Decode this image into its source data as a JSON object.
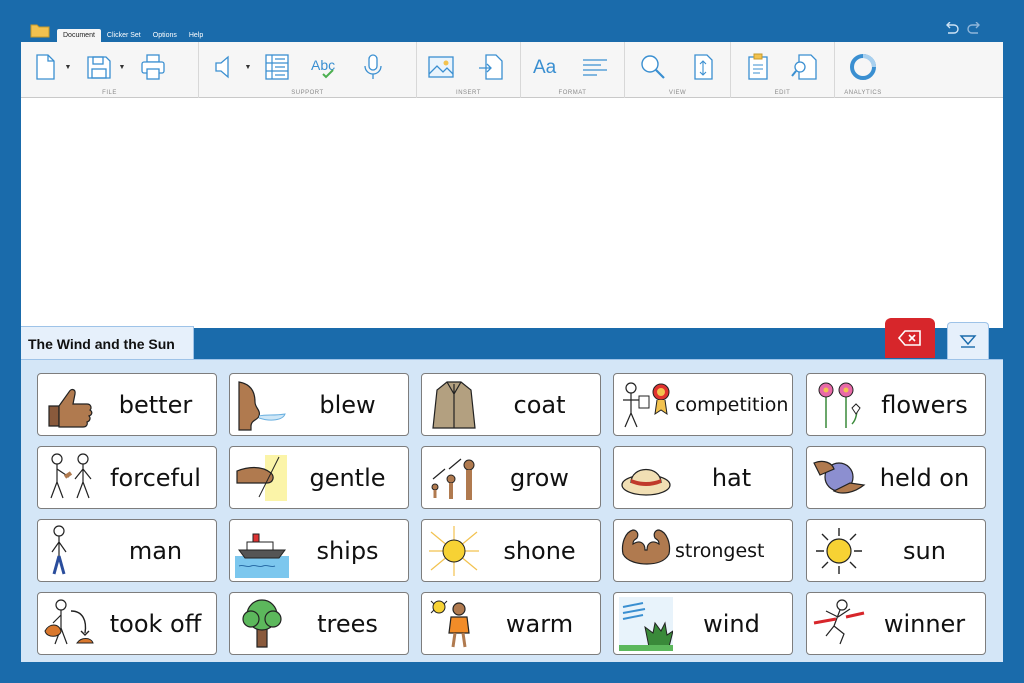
{
  "menu": {
    "tabs": [
      "Document",
      "Clicker Set",
      "Options",
      "Help"
    ],
    "active": "Document"
  },
  "ribbon": {
    "groups": [
      {
        "label": "FILE",
        "buttons": [
          "new-document-icon",
          "save-icon",
          "print-icon"
        ]
      },
      {
        "label": "SUPPORT",
        "buttons": [
          "speaker-icon",
          "list-icon",
          "spellcheck-icon",
          "microphone-icon"
        ]
      },
      {
        "label": "INSERT",
        "buttons": [
          "image-icon",
          "insert-file-icon"
        ]
      },
      {
        "label": "FORMAT",
        "buttons": [
          "font-icon",
          "paragraph-icon"
        ]
      },
      {
        "label": "VIEW",
        "buttons": [
          "zoom-icon",
          "page-size-icon"
        ]
      },
      {
        "label": "EDIT",
        "buttons": [
          "paste-icon",
          "find-icon"
        ]
      },
      {
        "label": "ANALYTICS",
        "buttons": [
          "analytics-icon"
        ]
      }
    ]
  },
  "clicker_set": {
    "title": "The Wind and the Sun",
    "words": [
      "better",
      "blew",
      "coat",
      "competition",
      "flowers",
      "forceful",
      "gentle",
      "grow",
      "hat",
      "held on",
      "man",
      "ships",
      "shone",
      "strongest",
      "sun",
      "took off",
      "trees",
      "warm",
      "wind",
      "winner"
    ]
  },
  "colors": {
    "frame": "#1a6bab",
    "grid_bg": "#d4e6f7",
    "delete": "#d7262b",
    "icon_blue": "#3a8fd1"
  }
}
